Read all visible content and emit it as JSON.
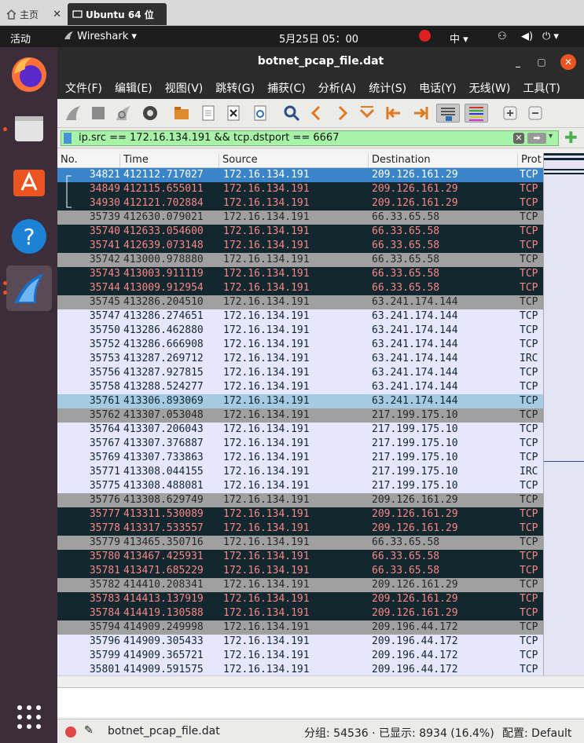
{
  "vm_tabs": {
    "home": "主页",
    "active": "Ubuntu 64 位",
    "close": "✕"
  },
  "topbar": {
    "activities": "活动",
    "app": "Wireshark",
    "clock": "5月25日 05：00",
    "lang": "中"
  },
  "window": {
    "title": "botnet_pcap_file.dat",
    "minimize": "_",
    "maximize": "▢",
    "close": "✕"
  },
  "menu": [
    "文件(F)",
    "编辑(E)",
    "视图(V)",
    "跳转(G)",
    "捕获(C)",
    "分析(A)",
    "统计(S)",
    "电话(Y)",
    "无线(W)",
    "工具(T)"
  ],
  "filter": {
    "value": "ip.src == 172.16.134.191 && tcp.dstport == 6667"
  },
  "columns": [
    "No.",
    "Time",
    "Source",
    "Destination",
    "Prot"
  ],
  "rows": [
    {
      "no": "34821",
      "time": "412112.717027",
      "src": "172.16.134.191",
      "dst": "209.126.161.29",
      "proto": "TCP",
      "style": "selected"
    },
    {
      "no": "34849",
      "time": "412115.655011",
      "src": "172.16.134.191",
      "dst": "209.126.161.29",
      "proto": "TCP",
      "style": "dark"
    },
    {
      "no": "34930",
      "time": "412121.702884",
      "src": "172.16.134.191",
      "dst": "209.126.161.29",
      "proto": "TCP",
      "style": "dark"
    },
    {
      "no": "35739",
      "time": "412630.079021",
      "src": "172.16.134.191",
      "dst": "66.33.65.58",
      "proto": "TCP",
      "style": "gray"
    },
    {
      "no": "35740",
      "time": "412633.054600",
      "src": "172.16.134.191",
      "dst": "66.33.65.58",
      "proto": "TCP",
      "style": "dark"
    },
    {
      "no": "35741",
      "time": "412639.073148",
      "src": "172.16.134.191",
      "dst": "66.33.65.58",
      "proto": "TCP",
      "style": "dark"
    },
    {
      "no": "35742",
      "time": "413000.978880",
      "src": "172.16.134.191",
      "dst": "66.33.65.58",
      "proto": "TCP",
      "style": "gray"
    },
    {
      "no": "35743",
      "time": "413003.911119",
      "src": "172.16.134.191",
      "dst": "66.33.65.58",
      "proto": "TCP",
      "style": "dark"
    },
    {
      "no": "35744",
      "time": "413009.912954",
      "src": "172.16.134.191",
      "dst": "66.33.65.58",
      "proto": "TCP",
      "style": "dark"
    },
    {
      "no": "35745",
      "time": "413286.204510",
      "src": "172.16.134.191",
      "dst": "63.241.174.144",
      "proto": "TCP",
      "style": "gray"
    },
    {
      "no": "35747",
      "time": "413286.274651",
      "src": "172.16.134.191",
      "dst": "63.241.174.144",
      "proto": "TCP",
      "style": "normal"
    },
    {
      "no": "35750",
      "time": "413286.462880",
      "src": "172.16.134.191",
      "dst": "63.241.174.144",
      "proto": "TCP",
      "style": "normal"
    },
    {
      "no": "35752",
      "time": "413286.666908",
      "src": "172.16.134.191",
      "dst": "63.241.174.144",
      "proto": "TCP",
      "style": "normal"
    },
    {
      "no": "35753",
      "time": "413287.269712",
      "src": "172.16.134.191",
      "dst": "63.241.174.144",
      "proto": "IRC",
      "style": "normal"
    },
    {
      "no": "35756",
      "time": "413287.927815",
      "src": "172.16.134.191",
      "dst": "63.241.174.144",
      "proto": "TCP",
      "style": "normal"
    },
    {
      "no": "35758",
      "time": "413288.524277",
      "src": "172.16.134.191",
      "dst": "63.241.174.144",
      "proto": "TCP",
      "style": "normal"
    },
    {
      "no": "35761",
      "time": "413306.893069",
      "src": "172.16.134.191",
      "dst": "63.241.174.144",
      "proto": "TCP",
      "style": "light"
    },
    {
      "no": "35762",
      "time": "413307.053048",
      "src": "172.16.134.191",
      "dst": "217.199.175.10",
      "proto": "TCP",
      "style": "gray"
    },
    {
      "no": "35764",
      "time": "413307.206043",
      "src": "172.16.134.191",
      "dst": "217.199.175.10",
      "proto": "TCP",
      "style": "normal"
    },
    {
      "no": "35767",
      "time": "413307.376887",
      "src": "172.16.134.191",
      "dst": "217.199.175.10",
      "proto": "TCP",
      "style": "normal"
    },
    {
      "no": "35769",
      "time": "413307.733863",
      "src": "172.16.134.191",
      "dst": "217.199.175.10",
      "proto": "TCP",
      "style": "normal"
    },
    {
      "no": "35771",
      "time": "413308.044155",
      "src": "172.16.134.191",
      "dst": "217.199.175.10",
      "proto": "IRC",
      "style": "normal"
    },
    {
      "no": "35775",
      "time": "413308.488081",
      "src": "172.16.134.191",
      "dst": "217.199.175.10",
      "proto": "TCP",
      "style": "normal"
    },
    {
      "no": "35776",
      "time": "413308.629749",
      "src": "172.16.134.191",
      "dst": "209.126.161.29",
      "proto": "TCP",
      "style": "gray"
    },
    {
      "no": "35777",
      "time": "413311.530089",
      "src": "172.16.134.191",
      "dst": "209.126.161.29",
      "proto": "TCP",
      "style": "dark"
    },
    {
      "no": "35778",
      "time": "413317.533557",
      "src": "172.16.134.191",
      "dst": "209.126.161.29",
      "proto": "TCP",
      "style": "dark"
    },
    {
      "no": "35779",
      "time": "413465.350716",
      "src": "172.16.134.191",
      "dst": "66.33.65.58",
      "proto": "TCP",
      "style": "gray"
    },
    {
      "no": "35780",
      "time": "413467.425931",
      "src": "172.16.134.191",
      "dst": "66.33.65.58",
      "proto": "TCP",
      "style": "dark"
    },
    {
      "no": "35781",
      "time": "413471.685229",
      "src": "172.16.134.191",
      "dst": "66.33.65.58",
      "proto": "TCP",
      "style": "dark"
    },
    {
      "no": "35782",
      "time": "414410.208341",
      "src": "172.16.134.191",
      "dst": "209.126.161.29",
      "proto": "TCP",
      "style": "gray"
    },
    {
      "no": "35783",
      "time": "414413.137919",
      "src": "172.16.134.191",
      "dst": "209.126.161.29",
      "proto": "TCP",
      "style": "dark"
    },
    {
      "no": "35784",
      "time": "414419.130588",
      "src": "172.16.134.191",
      "dst": "209.126.161.29",
      "proto": "TCP",
      "style": "dark"
    },
    {
      "no": "35794",
      "time": "414909.249998",
      "src": "172.16.134.191",
      "dst": "209.196.44.172",
      "proto": "TCP",
      "style": "gray"
    },
    {
      "no": "35796",
      "time": "414909.305433",
      "src": "172.16.134.191",
      "dst": "209.196.44.172",
      "proto": "TCP",
      "style": "normal"
    },
    {
      "no": "35799",
      "time": "414909.365721",
      "src": "172.16.134.191",
      "dst": "209.196.44.172",
      "proto": "TCP",
      "style": "normal"
    },
    {
      "no": "35801",
      "time": "414909.591575",
      "src": "172.16.134.191",
      "dst": "209.196.44.172",
      "proto": "TCP",
      "style": "normal"
    }
  ],
  "row_styles": {
    "selected": {
      "bg": "#3a84c9",
      "fg": "#ffffff"
    },
    "dark": {
      "bg": "#12272e",
      "fg": "#f78787"
    },
    "gray": {
      "bg": "#a0a0a0",
      "fg": "#272727"
    },
    "normal": {
      "bg": "#e7e6ff",
      "fg": "#12272e"
    },
    "light": {
      "bg": "#a4cbe2",
      "fg": "#12272e"
    }
  },
  "status": {
    "file": "botnet_pcap_file.dat",
    "counts": "分组: 54536 · 已显示: 8934 (16.4%)",
    "profile": "配置: Default"
  }
}
